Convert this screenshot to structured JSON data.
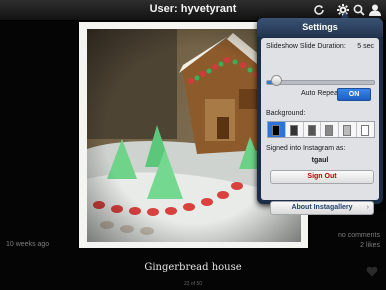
{
  "header": {
    "title": "User: hyvetyrant",
    "icons": [
      "refresh-icon",
      "gear-icon",
      "search-icon",
      "user-icon"
    ]
  },
  "photo": {
    "caption": "Gingerbread house",
    "posted": "10 weeks ago",
    "comments": "no comments",
    "likes": "2 likes",
    "counter": "22 of 50"
  },
  "settings": {
    "title": "Settings",
    "slideshow_label": "Slideshow Slide Duration:",
    "slideshow_value": "5 sec",
    "slideshow_level": 0.05,
    "auto_repeat_label": "Auto Repeat",
    "auto_repeat_state": "ON",
    "background_label": "Background:",
    "background_swatches": [
      "#000000",
      "#333333",
      "#555555",
      "#888888",
      "#bbbbbb",
      "#ffffff"
    ],
    "background_selected": 0,
    "signed_in_label": "Signed into Instagram as:",
    "username": "tgaul",
    "sign_out_label": "Sign Out",
    "about_label": "About Instagallery"
  },
  "colors": {
    "accent": "#2e78d6",
    "popover_frame": "#1c2d47",
    "sign_out_text": "#b30000"
  }
}
